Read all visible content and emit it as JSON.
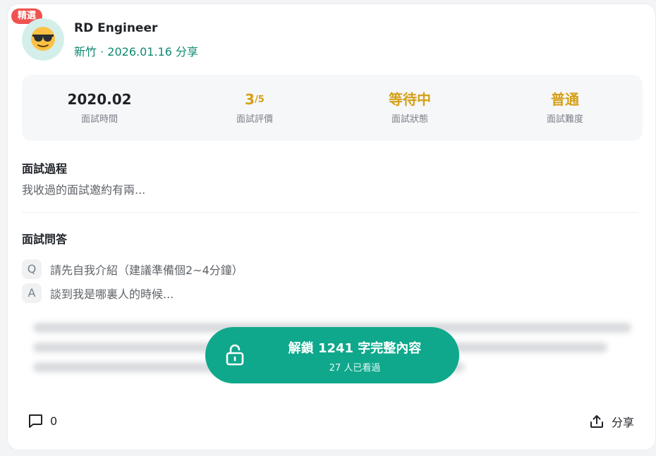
{
  "badge": "精選",
  "author": {
    "name": "RD Engineer",
    "location": "新竹",
    "separator": "·",
    "date": "2026.01.16",
    "action": "分享",
    "avatar_icon": "sunglasses-emoji-icon"
  },
  "stats": [
    {
      "value": "2020.02",
      "label": "面試時間"
    },
    {
      "value": "3",
      "suffix": "/5",
      "label": "面試評價"
    },
    {
      "value": "等待中",
      "label": "面試狀態"
    },
    {
      "value": "普通",
      "label": "面試難度"
    }
  ],
  "process": {
    "title": "面試過程",
    "text": "我收過的面試邀約有兩..."
  },
  "qa": {
    "title": "面試問答",
    "question_tag": "Q",
    "question": "請先自我介紹（建議準備個2~4分鐘）",
    "answer_tag": "A",
    "answer": "談到我是哪裏人的時候..."
  },
  "unlock": {
    "title": "解鎖 1241 字完整內容",
    "subtitle": "27 人已看過",
    "icon": "unlock-icon"
  },
  "footer": {
    "comment_count": "0",
    "share_label": "分享"
  },
  "colors": {
    "accent": "#0fa88c",
    "badge": "#ef5350",
    "gold": "#d4a017",
    "location_text": "#0f8a73"
  }
}
